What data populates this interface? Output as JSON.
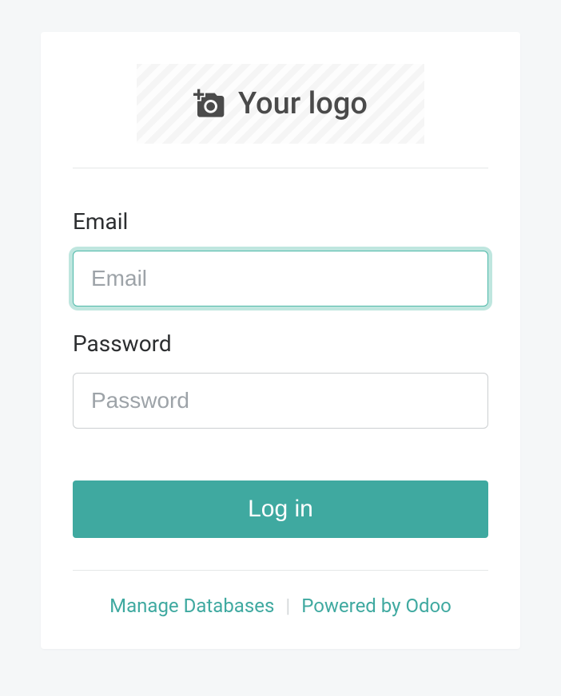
{
  "logo": {
    "placeholder_text": "Your logo"
  },
  "form": {
    "email": {
      "label": "Email",
      "placeholder": "Email",
      "value": ""
    },
    "password": {
      "label": "Password",
      "placeholder": "Password",
      "value": ""
    },
    "submit_label": "Log in"
  },
  "footer": {
    "manage_db_label": "Manage Databases",
    "powered_by_label": "Powered by Odoo",
    "separator": "|"
  },
  "colors": {
    "accent": "#3fa9a0",
    "focus_ring": "#bfe6df",
    "background": "#f5f7f8"
  }
}
